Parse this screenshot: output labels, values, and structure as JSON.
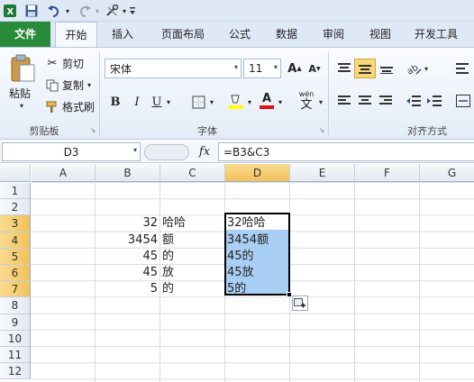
{
  "qat": {
    "excel_icon": "excel-icon",
    "save_icon": "save-icon",
    "undo_icon": "undo-icon",
    "redo_icon": "redo-icon"
  },
  "tabs": [
    {
      "label": "文件"
    },
    {
      "label": "开始"
    },
    {
      "label": "插入"
    },
    {
      "label": "页面布局"
    },
    {
      "label": "公式"
    },
    {
      "label": "数据"
    },
    {
      "label": "审阅"
    },
    {
      "label": "视图"
    },
    {
      "label": "开发工具"
    }
  ],
  "clipboard": {
    "paste": "粘贴",
    "cut": "剪切",
    "copy": "复制",
    "format_painter": "格式刷",
    "group": "剪贴板"
  },
  "font": {
    "name": "宋体",
    "size": "11",
    "bold": "B",
    "italic": "I",
    "underline": "U",
    "group": "字体",
    "grow": "A",
    "shrink": "A",
    "font_color": "A",
    "phonetic": "wén"
  },
  "alignment": {
    "group": "对齐方式"
  },
  "formula_bar": {
    "name_box": "D3",
    "fx": "fx",
    "formula": "=B3&C3"
  },
  "columns": [
    "A",
    "B",
    "C",
    "D",
    "E",
    "F",
    "G"
  ],
  "rows": [
    "1",
    "2",
    "3",
    "4",
    "5",
    "6",
    "7",
    "8",
    "9",
    "10",
    "11",
    "12"
  ],
  "cells": {
    "B": [
      "",
      "",
      "32",
      "3454",
      "45",
      "45",
      "5"
    ],
    "C": [
      "",
      "",
      "哈哈",
      "额",
      "的",
      "放",
      "的"
    ],
    "D": [
      "",
      "",
      "32哈哈",
      "3454额",
      "45的",
      "45放",
      "5的"
    ]
  },
  "selection": {
    "active_cell": "D3",
    "range": "D3:D7",
    "highlight": "#a9cff5",
    "fill_color": "#f1c15a"
  },
  "colors": {
    "file_tab": "#2a8a3c",
    "ribbon_bg": "#dfe9f5"
  }
}
